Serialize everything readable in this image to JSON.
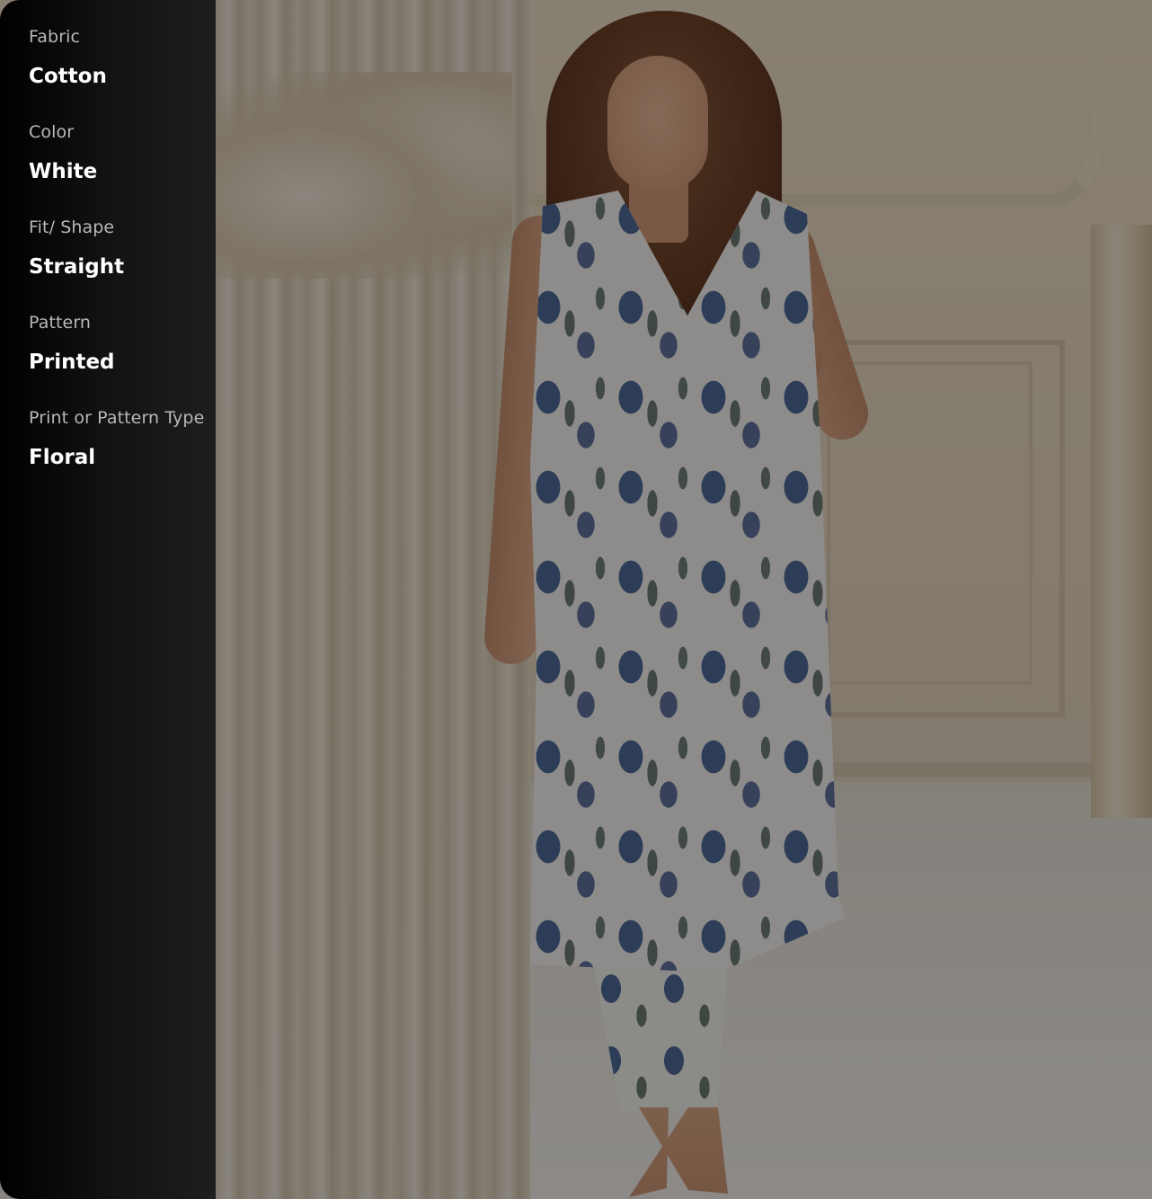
{
  "specifications": [
    {
      "label": "Fabric",
      "value": "Cotton"
    },
    {
      "label": "Color",
      "value": "White"
    },
    {
      "label": "Fit/ Shape",
      "value": "Straight"
    },
    {
      "label": "Pattern",
      "value": "Printed"
    },
    {
      "label": "Print or Pattern Type",
      "value": "Floral"
    }
  ],
  "product_image": {
    "icon": "product-photo",
    "overlay_color": "#000000"
  },
  "colors": {
    "panel_background": "#121212",
    "label_text": "#b8b8b8",
    "value_text": "#ffffff"
  }
}
